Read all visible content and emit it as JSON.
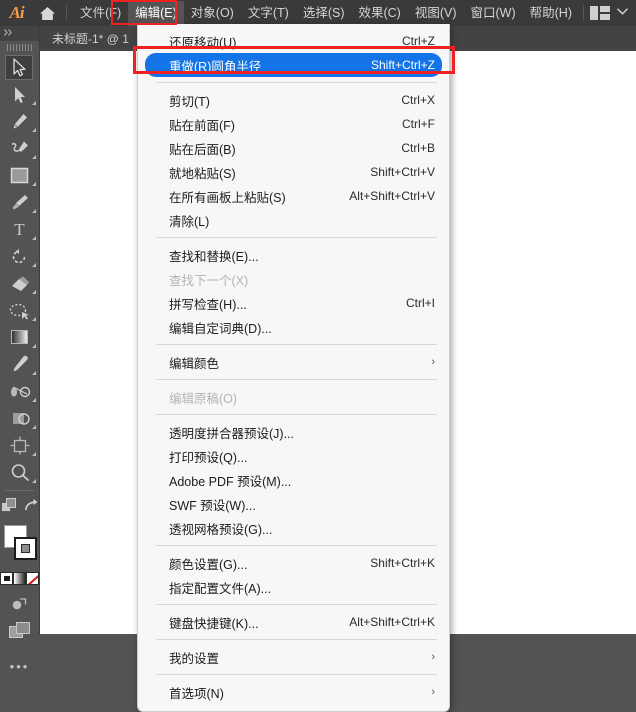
{
  "app": {
    "logo_text": "Ai",
    "home_icon": "home-icon"
  },
  "menubar": {
    "items": [
      {
        "label": "文件(F)",
        "active": false
      },
      {
        "label": "编辑(E)",
        "active": true
      },
      {
        "label": "对象(O)",
        "active": false
      },
      {
        "label": "文字(T)",
        "active": false
      },
      {
        "label": "选择(S)",
        "active": false
      },
      {
        "label": "效果(C)",
        "active": false
      },
      {
        "label": "视图(V)",
        "active": false
      },
      {
        "label": "窗口(W)",
        "active": false
      },
      {
        "label": "帮助(H)",
        "active": false
      }
    ],
    "workspace_icon": "workspace-switcher-icon",
    "chevron": "▼"
  },
  "document": {
    "tab_title": "未标题-1* @ 1"
  },
  "toolbar": {
    "collapse_label": "»",
    "tools": [
      {
        "name": "selection-tool",
        "selected": true,
        "corner": false
      },
      {
        "name": "direct-selection-tool",
        "selected": false,
        "corner": true
      },
      {
        "name": "pen-tool",
        "selected": false,
        "corner": true
      },
      {
        "name": "curvature-tool",
        "selected": false,
        "corner": true
      },
      {
        "name": "rectangle-tool",
        "selected": false,
        "corner": true
      },
      {
        "name": "paintbrush-tool",
        "selected": false,
        "corner": true
      },
      {
        "name": "type-tool",
        "selected": false,
        "corner": true
      },
      {
        "name": "rotate-tool",
        "selected": false,
        "corner": true
      },
      {
        "name": "eraser-tool",
        "selected": false,
        "corner": true
      },
      {
        "name": "lasso-tool",
        "selected": false,
        "corner": true
      },
      {
        "name": "gradient-tool",
        "selected": false,
        "corner": true
      },
      {
        "name": "eyedropper-tool",
        "selected": false,
        "corner": true
      },
      {
        "name": "blend-tool",
        "selected": false,
        "corner": true
      },
      {
        "name": "shape-builder-tool",
        "selected": false,
        "corner": true
      },
      {
        "name": "artboard-tool",
        "selected": false,
        "corner": true
      },
      {
        "name": "zoom-tool",
        "selected": false,
        "corner": true
      }
    ],
    "secondary": [
      {
        "name": "arrange-objects-icon"
      },
      {
        "name": "redo-arrow-icon"
      }
    ],
    "colors": {
      "fill": "#ffffff",
      "stroke": "#ffffff",
      "stroke_border": "#1d1d1d"
    },
    "modes": [
      {
        "name": "color-mode-icon"
      },
      {
        "name": "gradient-mode-icon"
      },
      {
        "name": "none-mode-icon"
      }
    ],
    "bottom": [
      {
        "name": "change-screen-mode-icon"
      },
      {
        "name": "screen-mode-icon"
      }
    ],
    "more_label": "•••"
  },
  "dropdown": {
    "name": "edit-menu",
    "groups": [
      {
        "items": [
          {
            "label": "还原移动(U)",
            "accel": "Ctrl+Z",
            "state": "normal"
          },
          {
            "label": "重做(R)圆角半径",
            "accel": "Shift+Ctrl+Z",
            "state": "highlighted"
          }
        ]
      },
      {
        "items": [
          {
            "label": "剪切(T)",
            "accel": "Ctrl+X",
            "state": "normal"
          },
          {
            "label": "贴在前面(F)",
            "accel": "Ctrl+F",
            "state": "normal"
          },
          {
            "label": "贴在后面(B)",
            "accel": "Ctrl+B",
            "state": "normal"
          },
          {
            "label": "就地粘贴(S)",
            "accel": "Shift+Ctrl+V",
            "state": "normal"
          },
          {
            "label": "在所有画板上粘贴(S)",
            "accel": "Alt+Shift+Ctrl+V",
            "state": "normal"
          },
          {
            "label": "清除(L)",
            "accel": "",
            "state": "normal"
          }
        ]
      },
      {
        "items": [
          {
            "label": "查找和替换(E)...",
            "accel": "",
            "state": "normal"
          },
          {
            "label": "查找下一个(X)",
            "accel": "",
            "state": "disabled"
          },
          {
            "label": "拼写检查(H)...",
            "accel": "Ctrl+I",
            "state": "normal"
          },
          {
            "label": "编辑自定词典(D)...",
            "accel": "",
            "state": "normal"
          }
        ]
      },
      {
        "items": [
          {
            "label": "编辑颜色",
            "accel": "",
            "state": "submenu"
          }
        ]
      },
      {
        "items": [
          {
            "label": "编辑原稿(O)",
            "accel": "",
            "state": "disabled"
          }
        ]
      },
      {
        "items": [
          {
            "label": "透明度拼合器预设(J)...",
            "accel": "",
            "state": "normal"
          },
          {
            "label": "打印预设(Q)...",
            "accel": "",
            "state": "normal"
          },
          {
            "label": "Adobe PDF 预设(M)...",
            "accel": "",
            "state": "normal"
          },
          {
            "label": "SWF 预设(W)...",
            "accel": "",
            "state": "normal"
          },
          {
            "label": "透视网格预设(G)...",
            "accel": "",
            "state": "normal"
          }
        ]
      },
      {
        "items": [
          {
            "label": "颜色设置(G)...",
            "accel": "Shift+Ctrl+K",
            "state": "normal"
          },
          {
            "label": "指定配置文件(A)...",
            "accel": "",
            "state": "normal"
          }
        ]
      },
      {
        "items": [
          {
            "label": "键盘快捷键(K)...",
            "accel": "Alt+Shift+Ctrl+K",
            "state": "normal"
          }
        ]
      },
      {
        "items": [
          {
            "label": "我的设置",
            "accel": "",
            "state": "submenu"
          }
        ]
      },
      {
        "items": [
          {
            "label": "首选项(N)",
            "accel": "",
            "state": "submenu"
          }
        ]
      }
    ],
    "submenu_arrow": "›"
  },
  "annotations": [
    {
      "name": "edit-menu-redbox",
      "color": "#ee2222"
    },
    {
      "name": "redo-item-redbox",
      "color": "#ee2222"
    }
  ]
}
